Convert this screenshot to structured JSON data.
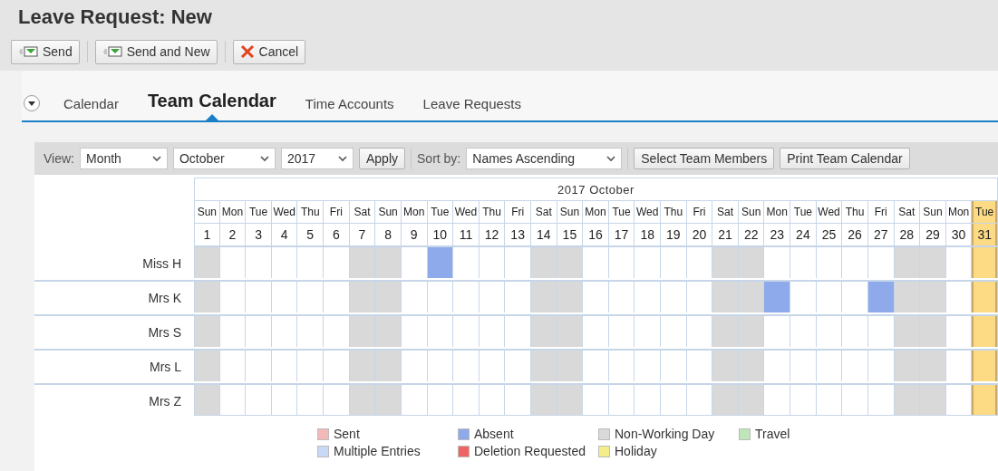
{
  "window": {
    "title": "Leave Request: New"
  },
  "toolbar": [
    {
      "label": "Send",
      "kind": "send"
    },
    {
      "label": "Send and New",
      "kind": "send"
    },
    {
      "label": "Cancel",
      "kind": "cancel"
    }
  ],
  "tabs": [
    {
      "label": "Calendar",
      "selected": false
    },
    {
      "label": "Team Calendar",
      "selected": true
    },
    {
      "label": "Time Accounts",
      "selected": false
    },
    {
      "label": "Leave Requests",
      "selected": false
    }
  ],
  "filters": {
    "view_label": "View:",
    "view": "Month",
    "month": "October",
    "year": "2017",
    "apply": "Apply",
    "sort_label": "Sort by:",
    "sort": "Names Ascending",
    "buttons": [
      "Select Team Members",
      "Print Team Calendar"
    ]
  },
  "calendar": {
    "title": "2017 October",
    "days": [
      {
        "weekday": "Sun",
        "day": "1",
        "kind": "off"
      },
      {
        "weekday": "Mon",
        "day": "2",
        "kind": "work"
      },
      {
        "weekday": "Tue",
        "day": "3",
        "kind": "work"
      },
      {
        "weekday": "Wed",
        "day": "4",
        "kind": "work"
      },
      {
        "weekday": "Thu",
        "day": "5",
        "kind": "work"
      },
      {
        "weekday": "Fri",
        "day": "6",
        "kind": "work"
      },
      {
        "weekday": "Sat",
        "day": "7",
        "kind": "off"
      },
      {
        "weekday": "Sun",
        "day": "8",
        "kind": "off"
      },
      {
        "weekday": "Mon",
        "day": "9",
        "kind": "work"
      },
      {
        "weekday": "Tue",
        "day": "10",
        "kind": "work"
      },
      {
        "weekday": "Wed",
        "day": "11",
        "kind": "work"
      },
      {
        "weekday": "Thu",
        "day": "12",
        "kind": "work"
      },
      {
        "weekday": "Fri",
        "day": "13",
        "kind": "work"
      },
      {
        "weekday": "Sat",
        "day": "14",
        "kind": "off"
      },
      {
        "weekday": "Sun",
        "day": "15",
        "kind": "off"
      },
      {
        "weekday": "Mon",
        "day": "16",
        "kind": "work"
      },
      {
        "weekday": "Tue",
        "day": "17",
        "kind": "work"
      },
      {
        "weekday": "Wed",
        "day": "18",
        "kind": "work"
      },
      {
        "weekday": "Thu",
        "day": "19",
        "kind": "work"
      },
      {
        "weekday": "Fri",
        "day": "20",
        "kind": "work"
      },
      {
        "weekday": "Sat",
        "day": "21",
        "kind": "off"
      },
      {
        "weekday": "Sun",
        "day": "22",
        "kind": "off"
      },
      {
        "weekday": "Mon",
        "day": "23",
        "kind": "work"
      },
      {
        "weekday": "Tue",
        "day": "24",
        "kind": "work"
      },
      {
        "weekday": "Wed",
        "day": "25",
        "kind": "work"
      },
      {
        "weekday": "Thu",
        "day": "26",
        "kind": "work"
      },
      {
        "weekday": "Fri",
        "day": "27",
        "kind": "work"
      },
      {
        "weekday": "Sat",
        "day": "28",
        "kind": "off"
      },
      {
        "weekday": "Sun",
        "day": "29",
        "kind": "off"
      },
      {
        "weekday": "Mon",
        "day": "30",
        "kind": "work"
      },
      {
        "weekday": "Tue",
        "day": "31",
        "kind": "holiday"
      }
    ],
    "members": [
      {
        "name": "Miss H",
        "cells": [
          {
            "absent": false
          },
          {
            "absent": false
          },
          {
            "absent": false
          },
          {
            "absent": false
          },
          {
            "absent": false
          },
          {
            "absent": false
          },
          {
            "absent": false
          },
          {
            "absent": false
          },
          {
            "absent": false
          },
          {
            "absent": true
          },
          {
            "absent": false
          },
          {
            "absent": false
          },
          {
            "absent": false
          },
          {
            "absent": false
          },
          {
            "absent": false
          },
          {
            "absent": false
          },
          {
            "absent": false
          },
          {
            "absent": false
          },
          {
            "absent": false
          },
          {
            "absent": false
          },
          {
            "absent": false
          },
          {
            "absent": false
          },
          {
            "absent": false
          },
          {
            "absent": false
          },
          {
            "absent": false
          },
          {
            "absent": false
          },
          {
            "absent": false
          },
          {
            "absent": false
          },
          {
            "absent": false
          },
          {
            "absent": false
          },
          {
            "absent": false
          }
        ]
      },
      {
        "name": "Mrs K",
        "cells": [
          {
            "absent": false
          },
          {
            "absent": false
          },
          {
            "absent": false
          },
          {
            "absent": false
          },
          {
            "absent": false
          },
          {
            "absent": false
          },
          {
            "absent": false
          },
          {
            "absent": false
          },
          {
            "absent": false
          },
          {
            "absent": false
          },
          {
            "absent": false
          },
          {
            "absent": false
          },
          {
            "absent": false
          },
          {
            "absent": false
          },
          {
            "absent": false
          },
          {
            "absent": false
          },
          {
            "absent": false
          },
          {
            "absent": false
          },
          {
            "absent": false
          },
          {
            "absent": false
          },
          {
            "absent": false
          },
          {
            "absent": false
          },
          {
            "absent": true
          },
          {
            "absent": false
          },
          {
            "absent": false
          },
          {
            "absent": false
          },
          {
            "absent": true
          },
          {
            "absent": false
          },
          {
            "absent": false
          },
          {
            "absent": false
          },
          {
            "absent": false
          }
        ]
      },
      {
        "name": "Mrs S",
        "cells": [
          {
            "absent": false
          },
          {
            "absent": false
          },
          {
            "absent": false
          },
          {
            "absent": false
          },
          {
            "absent": false
          },
          {
            "absent": false
          },
          {
            "absent": false
          },
          {
            "absent": false
          },
          {
            "absent": false
          },
          {
            "absent": false
          },
          {
            "absent": false
          },
          {
            "absent": false
          },
          {
            "absent": false
          },
          {
            "absent": false
          },
          {
            "absent": false
          },
          {
            "absent": false
          },
          {
            "absent": false
          },
          {
            "absent": false
          },
          {
            "absent": false
          },
          {
            "absent": false
          },
          {
            "absent": false
          },
          {
            "absent": false
          },
          {
            "absent": false
          },
          {
            "absent": false
          },
          {
            "absent": false
          },
          {
            "absent": false
          },
          {
            "absent": false
          },
          {
            "absent": false
          },
          {
            "absent": false
          },
          {
            "absent": false
          },
          {
            "absent": false
          }
        ]
      },
      {
        "name": "Mrs L",
        "cells": [
          {
            "absent": false
          },
          {
            "absent": false
          },
          {
            "absent": false
          },
          {
            "absent": false
          },
          {
            "absent": false
          },
          {
            "absent": false
          },
          {
            "absent": false
          },
          {
            "absent": false
          },
          {
            "absent": false
          },
          {
            "absent": false
          },
          {
            "absent": false
          },
          {
            "absent": false
          },
          {
            "absent": false
          },
          {
            "absent": false
          },
          {
            "absent": false
          },
          {
            "absent": false
          },
          {
            "absent": false
          },
          {
            "absent": false
          },
          {
            "absent": false
          },
          {
            "absent": false
          },
          {
            "absent": false
          },
          {
            "absent": false
          },
          {
            "absent": false
          },
          {
            "absent": false
          },
          {
            "absent": false
          },
          {
            "absent": false
          },
          {
            "absent": false
          },
          {
            "absent": false
          },
          {
            "absent": false
          },
          {
            "absent": false
          },
          {
            "absent": false
          }
        ]
      },
      {
        "name": "Mrs Z",
        "cells": [
          {
            "absent": false
          },
          {
            "absent": false
          },
          {
            "absent": false
          },
          {
            "absent": false
          },
          {
            "absent": false
          },
          {
            "absent": false
          },
          {
            "absent": false
          },
          {
            "absent": false
          },
          {
            "absent": false
          },
          {
            "absent": false
          },
          {
            "absent": false
          },
          {
            "absent": false
          },
          {
            "absent": false
          },
          {
            "absent": false
          },
          {
            "absent": false
          },
          {
            "absent": false
          },
          {
            "absent": false
          },
          {
            "absent": false
          },
          {
            "absent": false
          },
          {
            "absent": false
          },
          {
            "absent": false
          },
          {
            "absent": false
          },
          {
            "absent": false
          },
          {
            "absent": false
          },
          {
            "absent": false
          },
          {
            "absent": false
          },
          {
            "absent": false
          },
          {
            "absent": false
          },
          {
            "absent": false
          },
          {
            "absent": false
          },
          {
            "absent": false
          }
        ]
      }
    ]
  },
  "legend": [
    {
      "label": "Sent",
      "color": "#f4b8b8"
    },
    {
      "label": "Absent",
      "color": "#8eaaea"
    },
    {
      "label": "Non-Working Day",
      "color": "#d9d9d9"
    },
    {
      "label": "Travel",
      "color": "#bfe6b8"
    },
    {
      "label": "Multiple Entries",
      "color": "#c9d9f5"
    },
    {
      "label": "Deletion Requested",
      "color": "#ef6464"
    },
    {
      "label": "Holiday",
      "color": "#f5ec8a"
    }
  ]
}
